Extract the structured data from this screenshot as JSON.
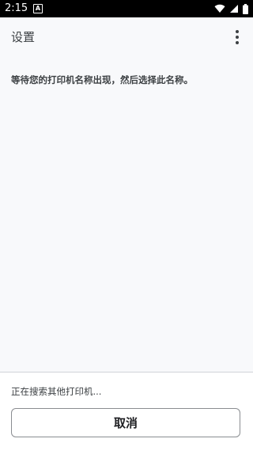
{
  "status_bar": {
    "time": "2:15",
    "notification_icon": "A",
    "icons": [
      "wifi-icon",
      "signal-icon",
      "battery-icon"
    ]
  },
  "app_bar": {
    "title": "设置",
    "overflow_icon": "more-vert-icon"
  },
  "main": {
    "instruction": "等待您的打印机名称出现，然后选择此名称。"
  },
  "bottom": {
    "searching_text": "正在搜索其他打印机...",
    "cancel_label": "取消"
  },
  "colors": {
    "background": "#f8f9fb",
    "status_bar": "#000000",
    "button_border": "#8a8d91"
  }
}
